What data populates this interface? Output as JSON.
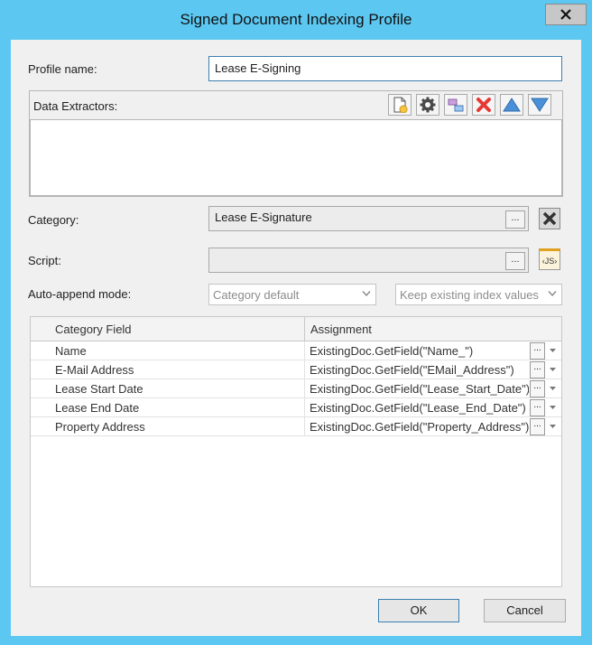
{
  "window": {
    "title": "Signed Document Indexing Profile",
    "close_label": "✕"
  },
  "profile": {
    "label": "Profile name:",
    "value": "Lease E-Signing"
  },
  "extractors": {
    "label": "Data Extractors:"
  },
  "category": {
    "label": "Category:",
    "value": "Lease E-Signature",
    "browse_label": "..."
  },
  "script": {
    "label": "Script:",
    "value": "",
    "browse_label": "...",
    "js_label": "‹JS›"
  },
  "auto_append": {
    "label": "Auto-append mode:",
    "mode_selected": "Category default",
    "index_selected": "Keep existing index values"
  },
  "grid": {
    "columns": [
      "Category Field",
      "Assignment"
    ],
    "rows": [
      {
        "field": "Name",
        "assignment": "ExistingDoc.GetField(\"Name_\")"
      },
      {
        "field": "E-Mail Address",
        "assignment": "ExistingDoc.GetField(\"EMail_Address\")"
      },
      {
        "field": "Lease Start Date",
        "assignment": "ExistingDoc.GetField(\"Lease_Start_Date\")"
      },
      {
        "field": "Lease End Date",
        "assignment": "ExistingDoc.GetField(\"Lease_End_Date\")"
      },
      {
        "field": "Property Address",
        "assignment": "ExistingDoc.GetField(\"Property_Address\")"
      }
    ],
    "row_button_label": "..."
  },
  "footer": {
    "ok_label": "OK",
    "cancel_label": "Cancel"
  },
  "colors": {
    "titlebar": "#5cc8f2",
    "dialog": "#f0f0f0",
    "delete_icon": "#e53935",
    "arrow_icon": "#4a90d9"
  }
}
